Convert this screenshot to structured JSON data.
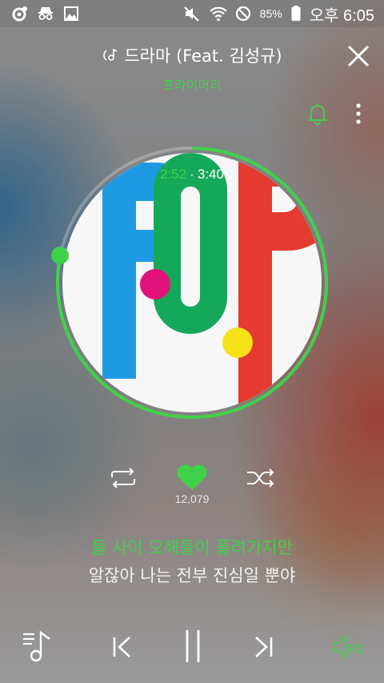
{
  "status_bar": {
    "battery": "85%",
    "time": "오후 6:05",
    "icons": [
      "circle-app-icon",
      "incognito-icon",
      "image-icon",
      "mute-icon",
      "wifi-icon",
      "block-icon",
      "battery-icon"
    ]
  },
  "header": {
    "title": "드라마 (Feat. 김성규)",
    "artist": "프라이머리",
    "close_icon": "close-icon",
    "bell_icon": "bell-icon",
    "more_icon": "more-vertical-icon"
  },
  "player": {
    "current_time": "2:52",
    "separator": "·",
    "total_time": "3:40",
    "progress": 0.782,
    "album_art_text": "POP"
  },
  "actions": {
    "repeat_icon": "repeat-icon",
    "like_icon": "heart-icon",
    "like_count": "12,079",
    "shuffle_icon": "shuffle-icon"
  },
  "lyrics": {
    "current": "둘 사이 오해들이 풀려가지만",
    "next": "알잖아 나는 전부 진심일 뿐야"
  },
  "bottom_bar": {
    "playlist_icon": "playlist-icon",
    "prev_icon": "previous-icon",
    "pause_icon": "pause-icon",
    "next_icon": "next-icon",
    "eq_label": "EQ"
  },
  "colors": {
    "accent": "#3fd14a",
    "pop_blue": "#1d9ae2",
    "pop_green": "#16a85a",
    "pop_red": "#e43a2f",
    "dot_pink": "#e2127a",
    "dot_yellow": "#f7e21a"
  }
}
